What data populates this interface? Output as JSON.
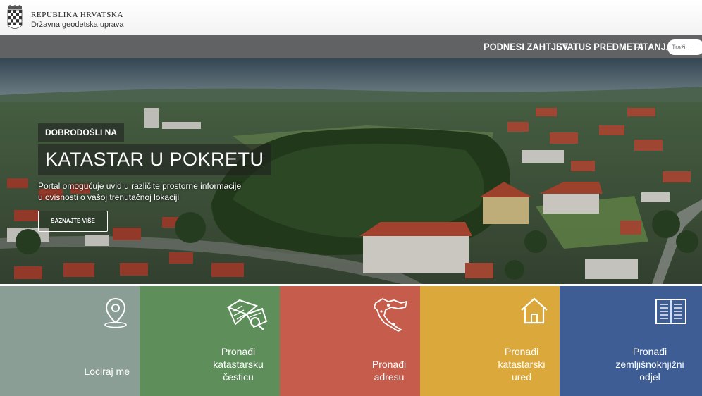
{
  "header": {
    "org_name": "REPUBLIKA HRVATSKA",
    "org_sub": "Državna geodetska uprava"
  },
  "nav": {
    "items": [
      "PODNESI ZAHTJEV",
      "STATUS PREDMETA",
      "PITANJA"
    ],
    "search_placeholder": "Traži..."
  },
  "hero": {
    "kicker": "DOBRODOŠLI NA",
    "title": "KATASTAR U POKRETU",
    "description": "Portal omogućuje uvid u različite prostorne informacije u ovisnosti o vašoj trenutačnoj lokaciji",
    "button": "SAZNAJTE VIŠE"
  },
  "tiles": [
    {
      "label": "Lociraj me",
      "icon": "location-pin-icon",
      "color": "#8a9e96"
    },
    {
      "label": "Pronađi katastarsku česticu",
      "icon": "parcel-map-icon",
      "color": "#5e8f5a"
    },
    {
      "label": "Pronađi adresu",
      "icon": "croatia-map-icon",
      "color": "#c65c4c"
    },
    {
      "label": "Pronađi katastarski ured",
      "icon": "house-icon",
      "color": "#dba83c"
    },
    {
      "label": "Pronađi zemljišnoknjižni odjel",
      "icon": "land-registry-book-icon",
      "color": "#3e5d94"
    }
  ]
}
